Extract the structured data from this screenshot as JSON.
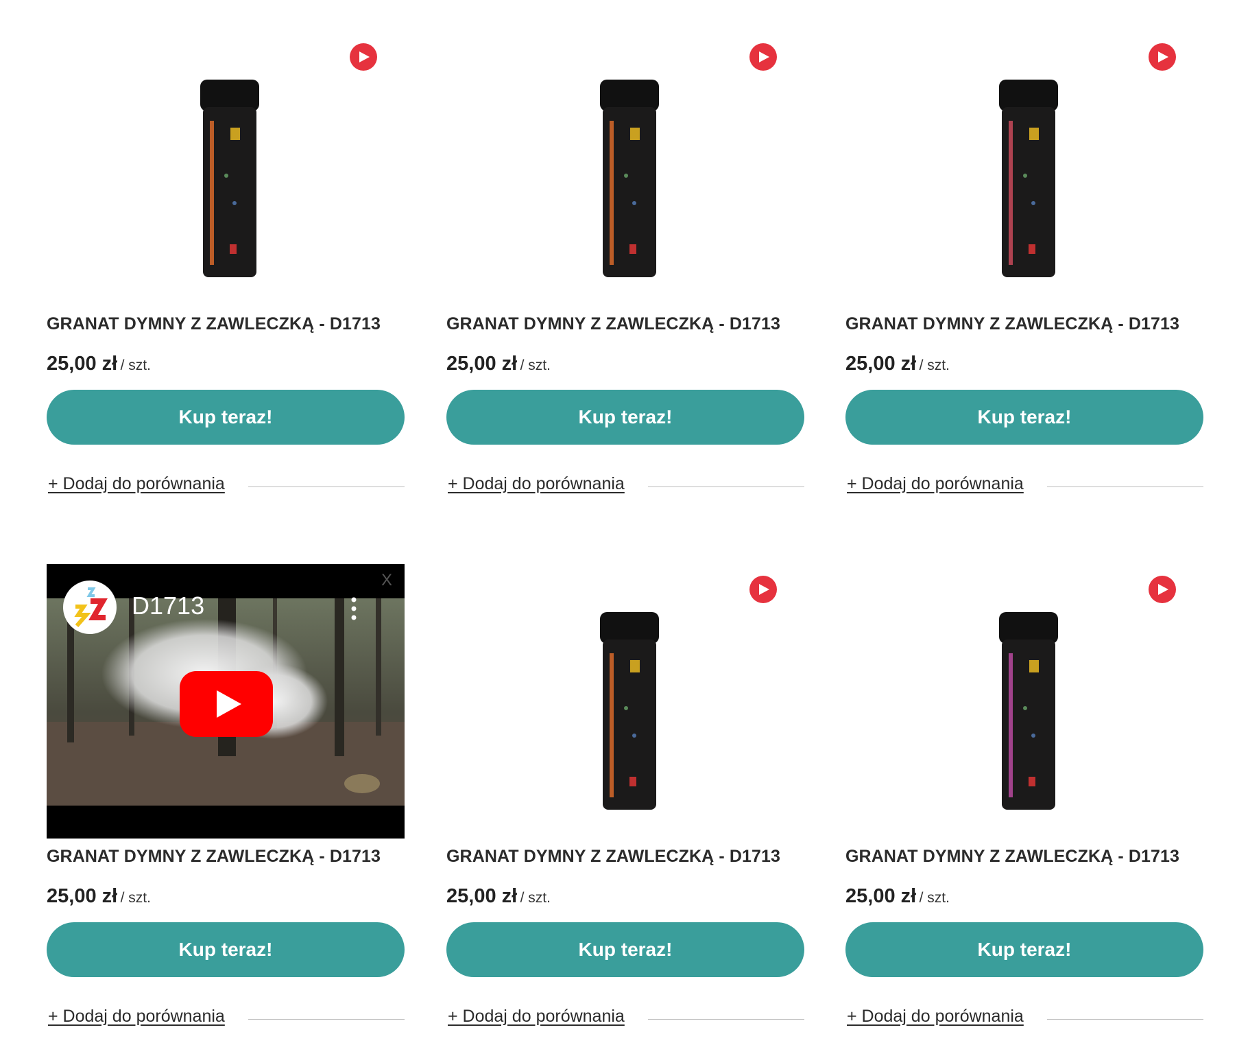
{
  "products": [
    {
      "title": "GRANAT DYMNY Z ZAWLECZKĄ - D1713",
      "price": "25,00 zł",
      "unit": "/ szt.",
      "buy_label": "Kup teraz!",
      "compare_label": "+ Dodaj do porównania",
      "media": "product-image",
      "label_color": "#d86a2a"
    },
    {
      "title": "GRANAT DYMNY Z ZAWLECZKĄ - D1713",
      "price": "25,00 zł",
      "unit": "/ szt.",
      "buy_label": "Kup teraz!",
      "compare_label": "+ Dodaj do porównania",
      "media": "product-image",
      "label_color": "#d86a2a"
    },
    {
      "title": "GRANAT DYMNY Z ZAWLECZKĄ - D1713",
      "price": "25,00 zł",
      "unit": "/ szt.",
      "buy_label": "Kup teraz!",
      "compare_label": "+ Dodaj do porównania",
      "media": "product-image",
      "label_color": "#c84a5a"
    },
    {
      "title": "GRANAT DYMNY Z ZAWLECZKĄ - D1713",
      "price": "25,00 zł",
      "unit": "/ szt.",
      "buy_label": "Kup teraz!",
      "compare_label": "+ Dodaj do porównania",
      "media": "video"
    },
    {
      "title": "GRANAT DYMNY Z ZAWLECZKĄ - D1713",
      "price": "25,00 zł",
      "unit": "/ szt.",
      "buy_label": "Kup teraz!",
      "compare_label": "+ Dodaj do porównania",
      "media": "product-image",
      "label_color": "#d86a2a"
    },
    {
      "title": "GRANAT DYMNY Z ZAWLECZKĄ - D1713",
      "price": "25,00 zł",
      "unit": "/ szt.",
      "buy_label": "Kup teraz!",
      "compare_label": "+ Dodaj do porównania",
      "media": "product-image",
      "label_color": "#b84aa0"
    }
  ],
  "video": {
    "title": "D1713",
    "close_label": "X",
    "icon": "youtube-play-icon"
  },
  "colors": {
    "accent": "#3a9e9b",
    "play_badge": "#e6323e",
    "youtube_red": "#ff0000"
  }
}
